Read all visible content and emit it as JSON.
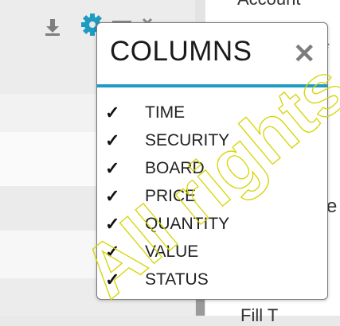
{
  "right_panel": {
    "top_text": "Account",
    "asterisk": "*",
    "mid_letter": "e",
    "bottom_text": "Fill T"
  },
  "toolbar": {
    "icons": [
      "download-icon",
      "gear-icon",
      "menu-icon",
      "close-icon"
    ]
  },
  "columns_popup": {
    "title": "COLUMNS",
    "close_symbol": "✕",
    "check_symbol": "✓",
    "accent_color": "#1e9bc3",
    "items": [
      {
        "label": "TIME",
        "checked": true
      },
      {
        "label": "SECURITY",
        "checked": true
      },
      {
        "label": "BOARD",
        "checked": true
      },
      {
        "label": "PRICE",
        "checked": true
      },
      {
        "label": "QUANTITY",
        "checked": true
      },
      {
        "label": "VALUE",
        "checked": true
      },
      {
        "label": "STATUS",
        "checked": true
      }
    ]
  },
  "watermark": {
    "text": "All rights"
  }
}
